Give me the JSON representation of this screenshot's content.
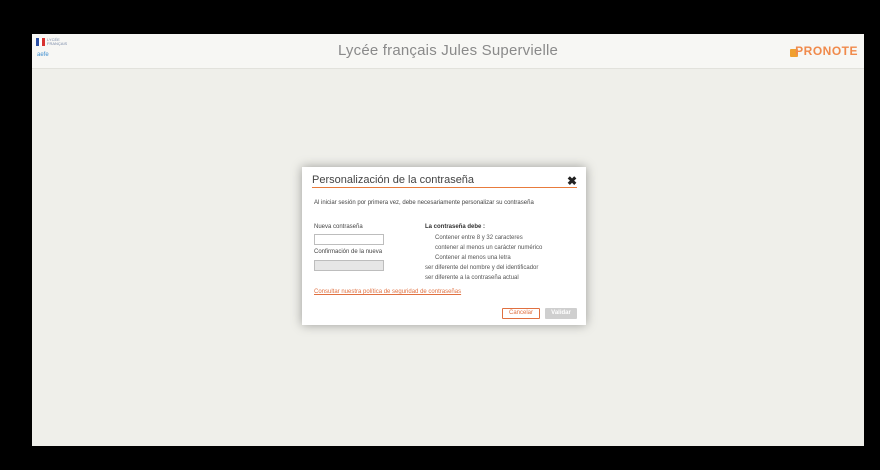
{
  "header": {
    "title": "Lycée français Jules Supervielle",
    "brand": "PRONOTE",
    "logo_small_text": "LYCÉE FRANÇAIS",
    "logo_sub": "aefe"
  },
  "dialog": {
    "title": "Personalización de la contraseña",
    "intro": "Al iniciar sesión por primera vez, debe necesariamente personalizar su contraseña",
    "new_password_label": "Nueva contraseña",
    "confirm_label": "Confirmación de la nueva",
    "rules_title": "La contraseña debe :",
    "rules": [
      "Contener entre 8 y 32 caracteres",
      "contener al menos un carácter numérico",
      "Contener al menos una letra",
      "ser diferente del nombre y del identificador",
      "ser diferente a la contraseña actual"
    ],
    "policy_link": "Consultar nuestra política de seguridad de contraseñas",
    "cancel_label": "Cancelar",
    "validate_label": "Validar"
  },
  "colors": {
    "accent": "#e07040",
    "background": "#efefea",
    "disabled": "#cfcfcf"
  }
}
